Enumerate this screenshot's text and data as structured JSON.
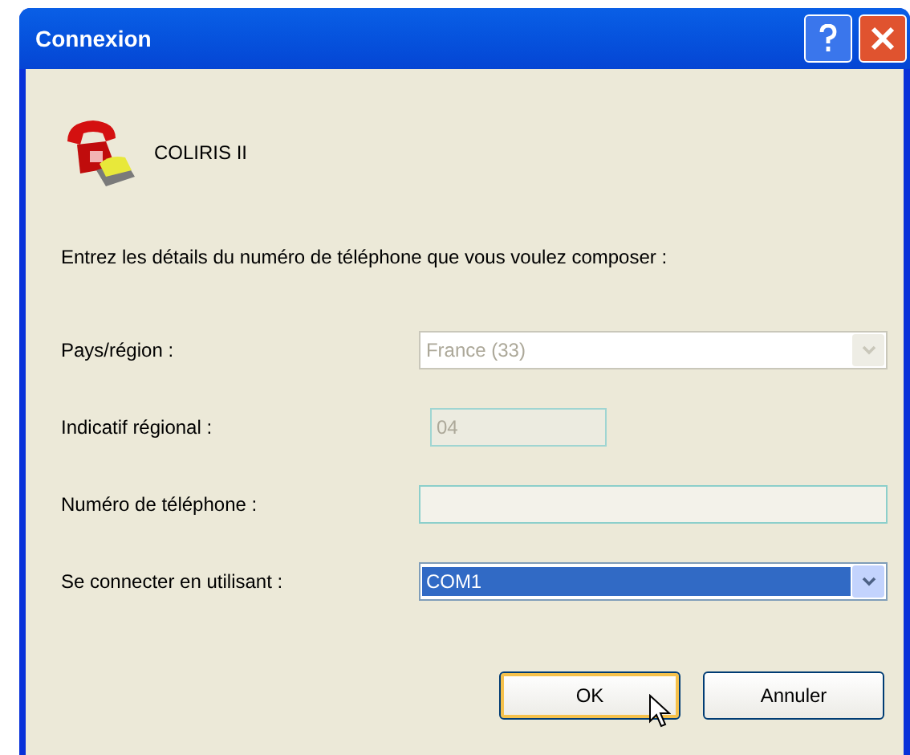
{
  "window": {
    "title": "Connexion"
  },
  "header": {
    "name": "COLIRIS II"
  },
  "prompt": "Entrez les détails du numéro de téléphone que vous voulez composer :",
  "fields": [
    {
      "label": "Pays/région :",
      "kind": "combo",
      "value": "France (33)",
      "disabled": true,
      "focused": false
    },
    {
      "label": "Indicatif régional :",
      "kind": "code",
      "value": "04",
      "disabled": true,
      "focused": false
    },
    {
      "label": "Numéro de téléphone :",
      "kind": "text",
      "disabled": false,
      "focused": false
    },
    {
      "label": "Se connecter en utilisant :",
      "kind": "combo",
      "value": "COM1",
      "disabled": false,
      "focused": true
    }
  ],
  "buttons": [
    {
      "label": "OK",
      "default": true
    },
    {
      "label": "Annuler",
      "default": false
    }
  ]
}
